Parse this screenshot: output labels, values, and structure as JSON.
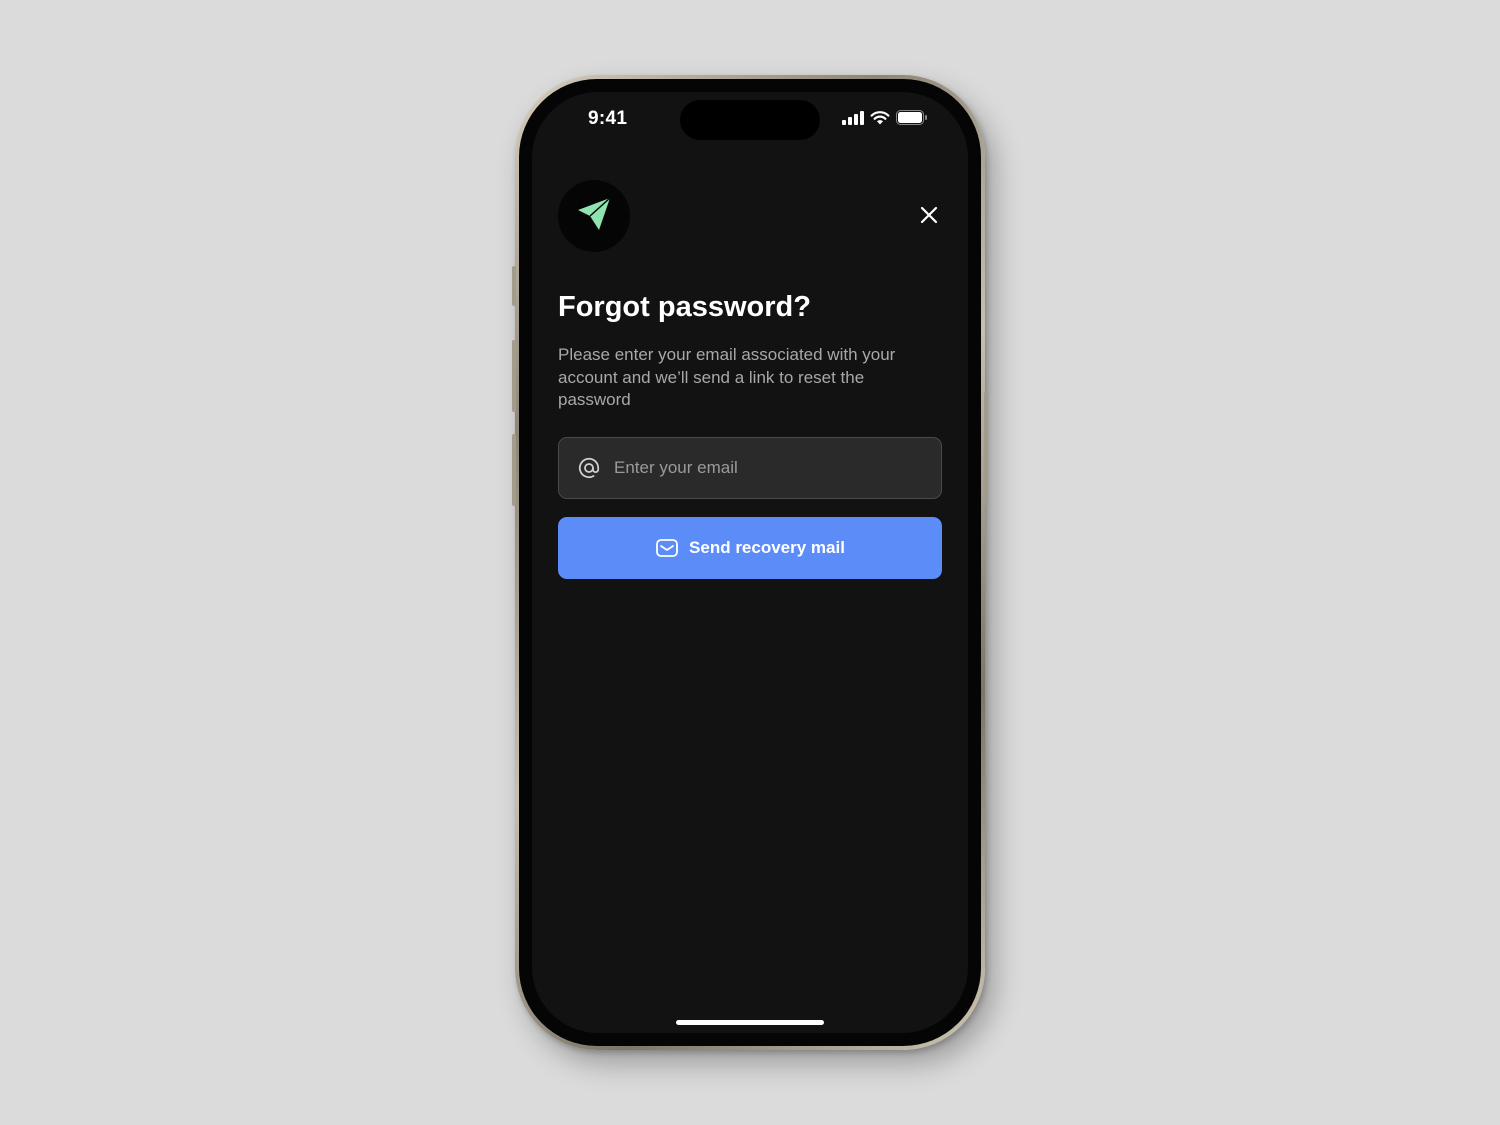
{
  "status_bar": {
    "time": "9:41",
    "icons": [
      "cellular-signal-icon",
      "wifi-icon",
      "battery-icon"
    ]
  },
  "header": {
    "logo_icon": "paper-plane-icon",
    "close_icon": "close-icon"
  },
  "content": {
    "title": "Forgot password?",
    "description": "Please enter your email associated with your account and we’ll send a link to reset the password"
  },
  "email_input": {
    "icon": "at-sign-icon",
    "placeholder": "Enter your email",
    "value": ""
  },
  "submit_button": {
    "icon": "mail-icon",
    "label": "Send recovery mail"
  },
  "colors": {
    "background": "#dbdbdb",
    "screen": "#121212",
    "accent": "#5b8cf7",
    "logo_green": "#8fe3b0",
    "input_bg": "#2a2a2a",
    "text_secondary": "#a8a8a8"
  }
}
